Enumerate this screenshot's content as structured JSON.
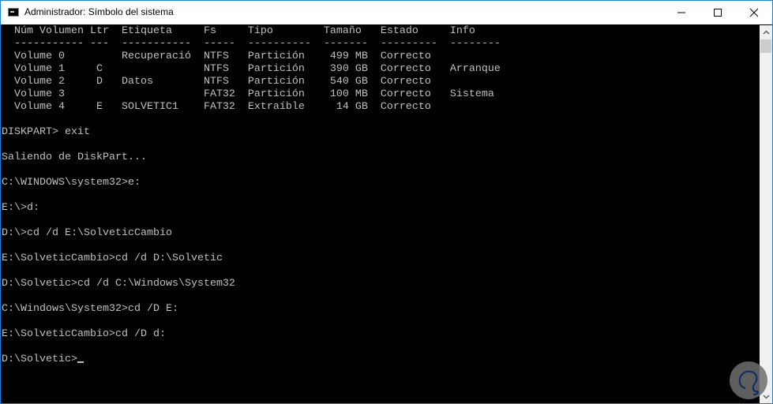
{
  "window": {
    "title": "Administrador: Símbolo del sistema"
  },
  "console": {
    "lines": [
      "  Núm Volumen Ltr  Etiqueta     Fs     Tipo        Tamaño   Estado     Info",
      "  ----------- ---  -----------  -----  ----------  -------  ---------  --------",
      "  Volume 0         Recuperació  NTFS   Partición    499 MB  Correcto",
      "  Volume 1     C                NTFS   Partición    390 GB  Correcto   Arranque",
      "  Volume 2     D   Datos        NTFS   Partición    540 GB  Correcto",
      "  Volume 3                      FAT32  Partición    100 MB  Correcto   Sistema",
      "  Volume 4     E   SOLVETIC1    FAT32  Extraíble     14 GB  Correcto",
      "",
      "DISKPART> exit",
      "",
      "Saliendo de DiskPart...",
      "",
      "C:\\WINDOWS\\system32>e:",
      "",
      "E:\\>d:",
      "",
      "D:\\>cd /d E:\\SolveticCambio",
      "",
      "E:\\SolveticCambio>cd /d D:\\Solvetic",
      "",
      "D:\\Solvetic>cd /d C:\\Windows\\System32",
      "",
      "C:\\Windows\\System32>cd /D E:",
      "",
      "E:\\SolveticCambio>cd /D d:",
      ""
    ],
    "prompt": "D:\\Solvetic>"
  }
}
